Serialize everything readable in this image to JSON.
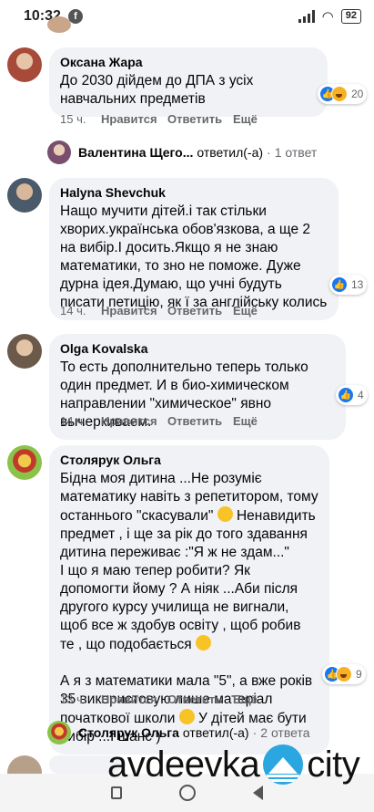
{
  "status_bar": {
    "time": "10:32",
    "app_badge": "f",
    "battery": "92"
  },
  "comments": [
    {
      "author": "Оксана Жара",
      "text": "До 2030 дійдем до ДПА з усіх навчальних предметів",
      "time": "15 ч.",
      "like_label": "Нравится",
      "reply_label": "Ответить",
      "more_label": "Ещё",
      "reaction_count": "20",
      "reaction_types": [
        "like-icon",
        "haha-icon"
      ]
    },
    {
      "author": "Halyna Shevchuk",
      "text": "Нащо мучити дітей.і так стільки хворих.українська обов'язкова, а ще 2 на вибір.І досить.Якщо я не знаю математики, то зно не поможе. Дуже дурна ідея.Думаю, що учні будуть писати петицію, як ї за англійську колись",
      "time": "14 ч.",
      "like_label": "Нравится",
      "reply_label": "Ответить",
      "more_label": "Ещё",
      "reaction_count": "13",
      "reaction_types": [
        "like-icon"
      ]
    },
    {
      "author": "Olga Kovalska",
      "text": "То есть дополнительно теперь только один предмет. И в био-химическом направлении \"химическое\" явно вычеркиваем.",
      "time": "14 ч.",
      "like_label": "Нравится",
      "reply_label": "Ответить",
      "more_label": "Ещё",
      "reaction_count": "4",
      "reaction_types": [
        "like-icon"
      ]
    },
    {
      "author": "Столярук Ольга",
      "text_parts": [
        "Бідна моя дитина ...Не розуміє математику навіть з репетитором, тому останнього \"скасували\"",
        " Ненавидить предмет , і ще за рік до того здавання дитина переживає :\"Я ж не здам...\"\nІ що я маю тепер робити? Як допомогти йому ? А ніяк ...Аби після другого курсу училища не вигнали, щоб все ж здобув освіту , щоб робив те , що подобається ",
        "\n\nА я з математики мала \"5\", а вже років 35 використовую лише матеріал початкової школи",
        " У дітей має бути вибір ...І шанс )"
      ],
      "time": "13 ч.",
      "like_label": "Нравится",
      "reply_label": "Ответить",
      "more_label": "Ещё",
      "reaction_count": "9",
      "reaction_types": [
        "like-icon",
        "haha-icon"
      ]
    }
  ],
  "reply_threads": [
    {
      "name": "Валентина Щего...",
      "verb": "ответил(-а)",
      "dot": "·",
      "count": "1 ответ"
    },
    {
      "name": "Столярук Ольга",
      "verb": "ответил(-а)",
      "dot": "·",
      "count": "2 ответа"
    }
  ],
  "watermark": {
    "left": "avdeevka",
    "right": "city"
  },
  "colors": {
    "bubble": "#f0f2f5",
    "meta_text": "#65676b",
    "like_blue": "#1877f2",
    "haha_yellow": "#f7b125"
  }
}
